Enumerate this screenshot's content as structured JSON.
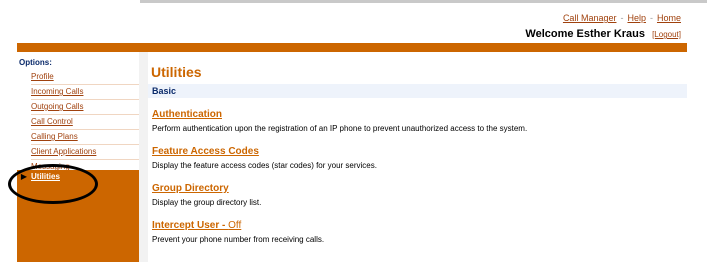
{
  "header": {
    "links": [
      "Call Manager",
      "Help",
      "Home"
    ],
    "welcome": "Welcome Esther Kraus",
    "logout": "[Logout]"
  },
  "sidebar": {
    "title": "Options:",
    "items": [
      "Profile",
      "Incoming Calls",
      "Outgoing Calls",
      "Call Control",
      "Calling Plans",
      "Client Applications",
      "Messaging"
    ],
    "active": "Utilities"
  },
  "main": {
    "title": "Utilities",
    "section": "Basic",
    "entries": [
      {
        "link": "Authentication",
        "desc": "Perform authentication upon the registration of an IP phone to prevent unauthorized access to the system."
      },
      {
        "link": "Feature Access Codes",
        "desc": "Display the feature access codes (star codes) for your services."
      },
      {
        "link": "Group Directory",
        "desc": "Display the group directory list."
      },
      {
        "link": "Intercept User - ",
        "status": "Off",
        "desc": "Prevent your phone number from receiving calls."
      }
    ]
  },
  "colors": {
    "accent": "#cc6600",
    "link": "#a0410d",
    "section_bg": "#eef3fb"
  }
}
